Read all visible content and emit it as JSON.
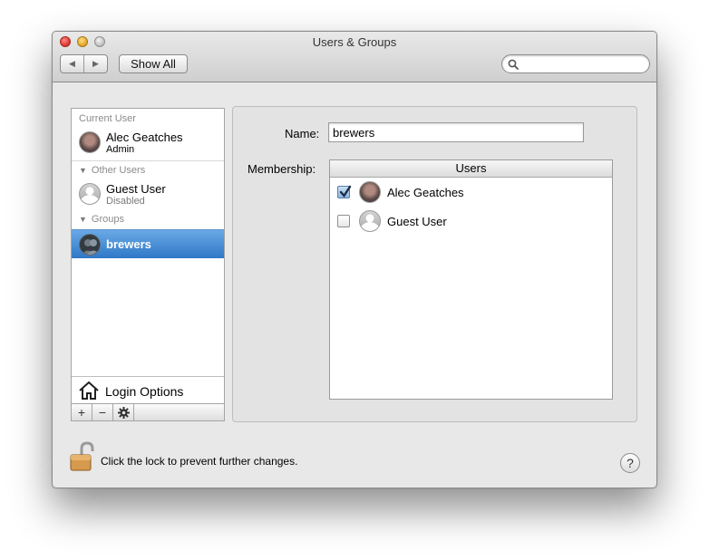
{
  "window": {
    "title": "Users & Groups"
  },
  "toolbar": {
    "back_glyph": "◀",
    "forward_glyph": "▶",
    "show_all_label": "Show All",
    "search_placeholder": ""
  },
  "sidebar": {
    "current_user_header": "Current User",
    "current_user": {
      "name": "Alec Geatches",
      "role": "Admin"
    },
    "other_users_header": "Other Users",
    "other_users": [
      {
        "name": "Guest User",
        "status": "Disabled"
      }
    ],
    "groups_header": "Groups",
    "groups": [
      {
        "name": "brewers",
        "selected": true
      }
    ],
    "login_options_label": "Login Options",
    "add_glyph": "+",
    "remove_glyph": "−"
  },
  "detail": {
    "name_label": "Name:",
    "name_value": "brewers",
    "membership_label": "Membership:",
    "members_column_header": "Users",
    "members": [
      {
        "name": "Alec Geatches",
        "checked": true
      },
      {
        "name": "Guest User",
        "checked": false
      }
    ]
  },
  "footer": {
    "lock_text": "Click the lock to prevent further changes.",
    "help_glyph": "?"
  },
  "colors": {
    "selection": "#2f78c7",
    "window_bg": "#e8e8e8"
  }
}
